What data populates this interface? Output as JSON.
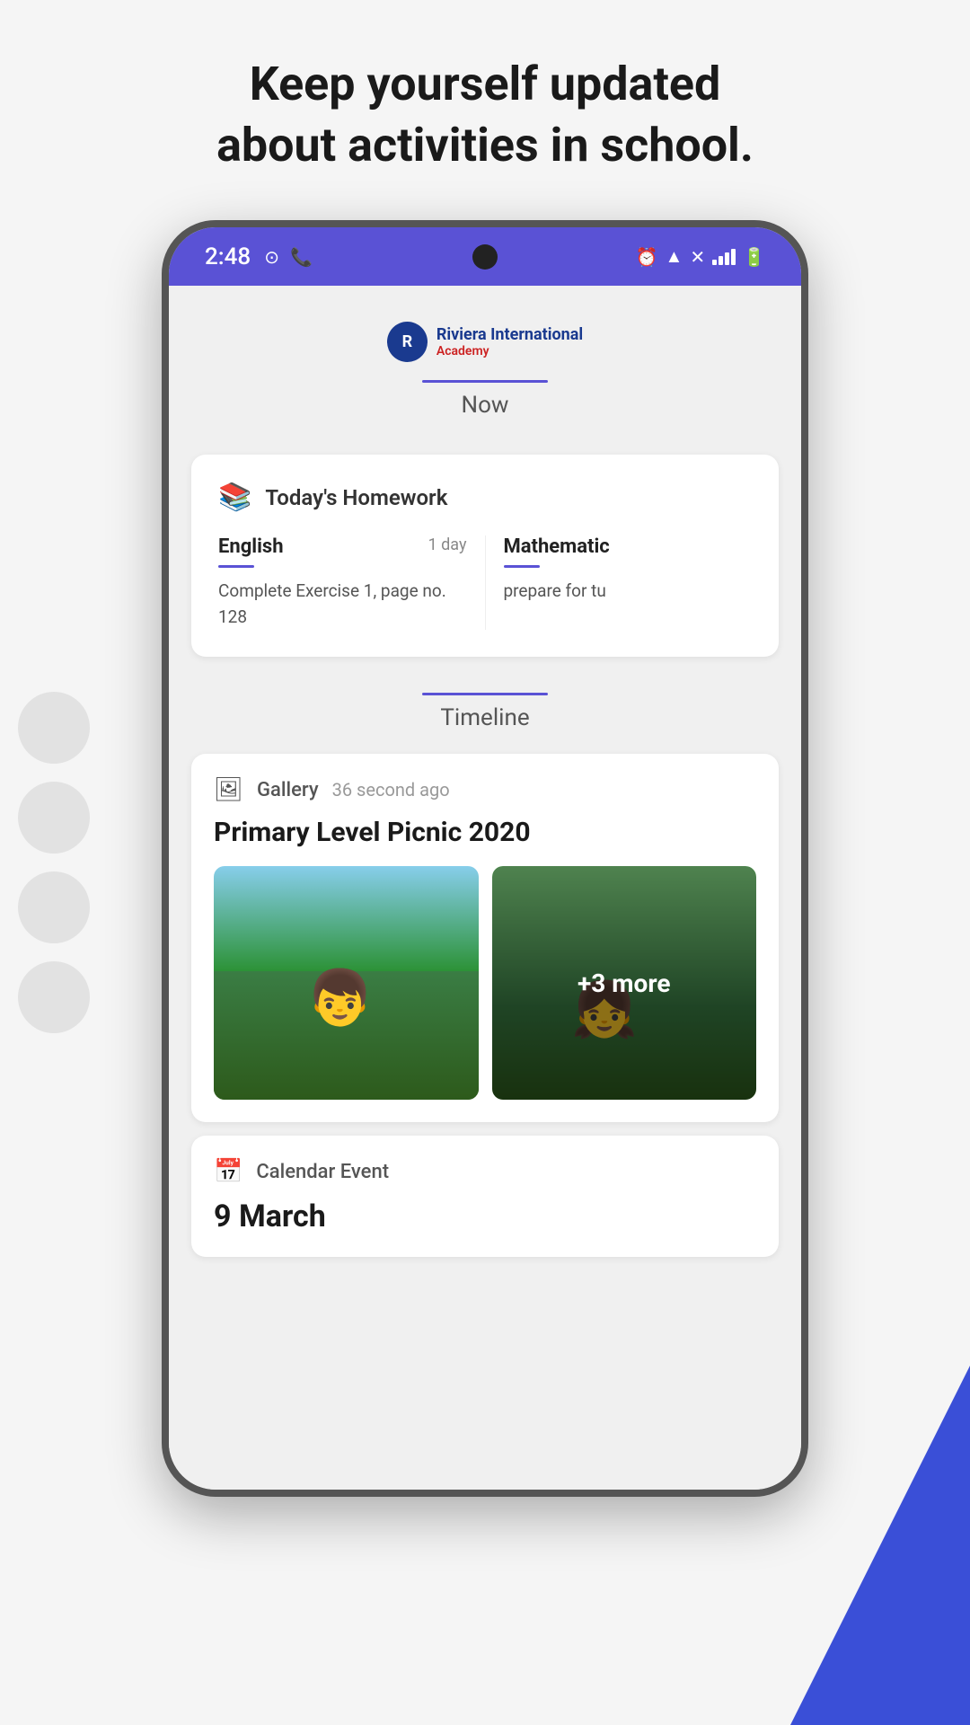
{
  "header": {
    "title_line1": "Keep yourself updated",
    "title_line2": "about activities in school."
  },
  "statusBar": {
    "time": "2:48",
    "leftIcons": [
      "maps-icon",
      "whatsapp-icon"
    ],
    "rightIcons": [
      "alarm-icon",
      "wifi-icon",
      "signal-icon",
      "battery-icon"
    ]
  },
  "logo": {
    "schoolName": "Riviera International",
    "schoolSubtitle": "Academy",
    "logoLetter": "R"
  },
  "nowTab": {
    "label": "Now"
  },
  "homeworkCard": {
    "title": "Today's Homework",
    "subjects": [
      {
        "name": "English",
        "days": "1 day",
        "description": "Complete Exercise 1, page no. 128"
      },
      {
        "name": "Mathematic",
        "days": "",
        "description": "prepare for tu"
      }
    ]
  },
  "timelineTab": {
    "label": "Timeline"
  },
  "galleryCard": {
    "type": "Gallery",
    "time": "36 second ago",
    "title": "Primary Level Picnic 2020",
    "moreCount": "+3 more"
  },
  "calendarCard": {
    "type": "Calendar Event",
    "date": "9 March"
  }
}
